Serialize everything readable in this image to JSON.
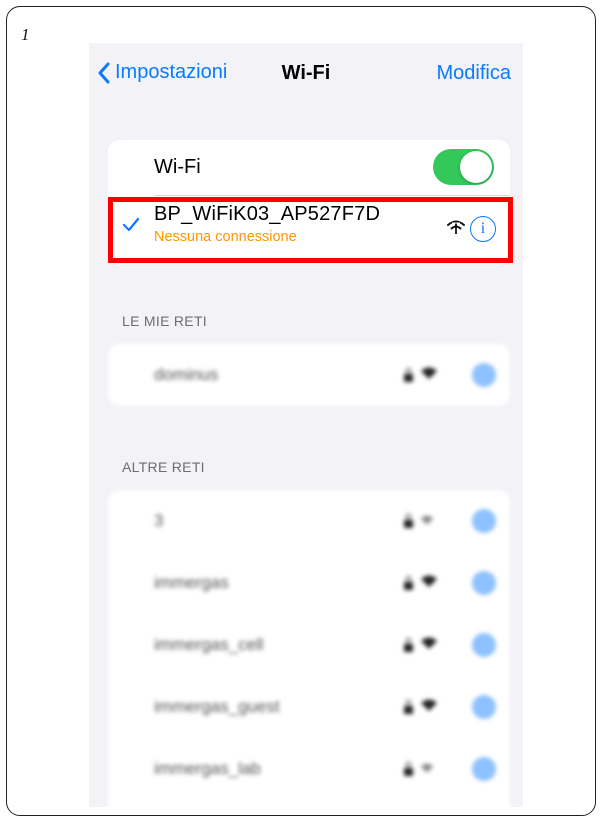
{
  "step_number": "1",
  "nav": {
    "back_label": "Impostazioni",
    "title": "Wi-Fi",
    "edit_label": "Modifica"
  },
  "wifi_toggle": {
    "label": "Wi-Fi",
    "on": true
  },
  "current_network": {
    "name": "BP_WiFiK03_AP527F7D",
    "status": "Nessuna connessione",
    "icons": [
      "checkmark-icon",
      "no-internet-wifi-icon",
      "info-icon"
    ]
  },
  "my_networks": {
    "header": "LE MIE RETI",
    "items": [
      {
        "name": "dominus"
      }
    ]
  },
  "other_networks": {
    "header": "ALTRE RETI",
    "items": [
      {
        "name": "3"
      },
      {
        "name": "immergas"
      },
      {
        "name": "immergas_cell"
      },
      {
        "name": "immergas_guest"
      },
      {
        "name": "immergas_lab"
      }
    ]
  },
  "colors": {
    "accent": "#0a7aff",
    "toggle_on": "#34c759",
    "warning": "#ff9500",
    "highlight": "#ff0000",
    "background": "#f2f2f7"
  }
}
